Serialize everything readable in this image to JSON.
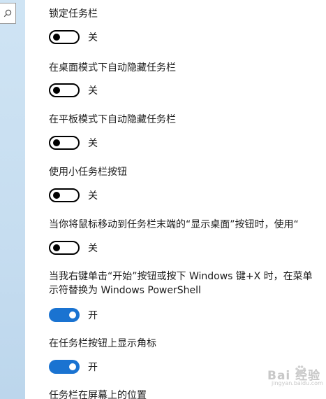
{
  "settings": [
    {
      "label": "锁定任务栏",
      "state": "关",
      "on": false
    },
    {
      "label": "在桌面模式下自动隐藏任务栏",
      "state": "关",
      "on": false
    },
    {
      "label": "在平板模式下自动隐藏任务栏",
      "state": "关",
      "on": false
    },
    {
      "label": "使用小任务栏按钮",
      "state": "关",
      "on": false
    },
    {
      "label": "当你将鼠标移动到任务栏末端的“显示桌面”按钮时，使用“",
      "state": "关",
      "on": false
    },
    {
      "label_line1": "当我右键单击“开始”按钮或按下 Windows 键+X 时，在菜单",
      "label_line2": "示符替换为 Windows PowerShell",
      "state": "开",
      "on": true
    },
    {
      "label": "在任务栏按钮上显示角标",
      "state": "开",
      "on": true
    },
    {
      "label": "任务栏在屏幕上的位置"
    }
  ],
  "watermark": {
    "text": "Bai 经验",
    "url": "jingyan.baidu.com"
  },
  "colors": {
    "toggle_on": "#1a73d1",
    "left_strip": "#c6ddf0"
  },
  "icons": {
    "search": "search-icon"
  }
}
